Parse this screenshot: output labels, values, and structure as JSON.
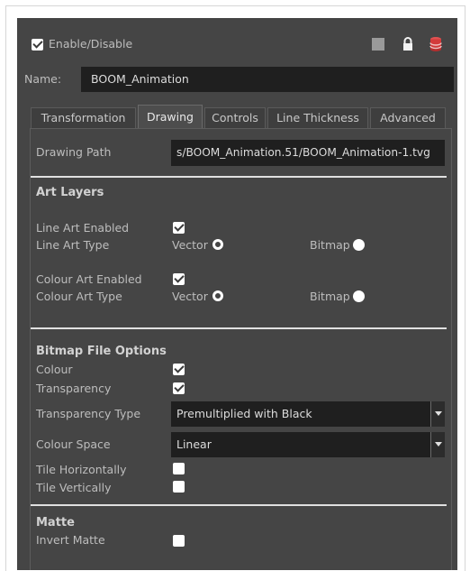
{
  "header": {
    "enable_label": "Enable/Disable",
    "enable_checked": true,
    "name_label": "Name:",
    "name_value": "BOOM_Animation",
    "icons": [
      "square-swatch-icon",
      "lock-icon",
      "database-icon"
    ],
    "accent_color": "#d33a3a"
  },
  "tabs": [
    {
      "label": "Transformation",
      "active": false
    },
    {
      "label": "Drawing",
      "active": true
    },
    {
      "label": "Controls",
      "active": false
    },
    {
      "label": "Line Thickness",
      "active": false
    },
    {
      "label": "Advanced",
      "active": false
    }
  ],
  "drawing": {
    "path_label": "Drawing Path",
    "path_value": "s/BOOM_Animation.51/BOOM_Animation-1.tvg"
  },
  "art_layers": {
    "heading": "Art Layers",
    "line_art_enabled_label": "Line Art Enabled",
    "line_art_enabled": true,
    "line_art_type_label": "Line Art Type",
    "colour_art_enabled_label": "Colour Art Enabled",
    "colour_art_enabled": true,
    "colour_art_type_label": "Colour Art Type",
    "vector_label": "Vector",
    "bitmap_label": "Bitmap"
  },
  "bitmap_options": {
    "heading": "Bitmap File Options",
    "colour_label": "Colour",
    "colour": true,
    "transparency_label": "Transparency",
    "transparency": true,
    "transparency_type_label": "Transparency Type",
    "transparency_type_value": "Premultiplied with Black",
    "colour_space_label": "Colour Space",
    "colour_space_value": "Linear",
    "tile_h_label": "Tile Horizontally",
    "tile_h": false,
    "tile_v_label": "Tile Vertically",
    "tile_v": false
  },
  "matte": {
    "heading": "Matte",
    "invert_label": "Invert Matte",
    "invert": false
  }
}
